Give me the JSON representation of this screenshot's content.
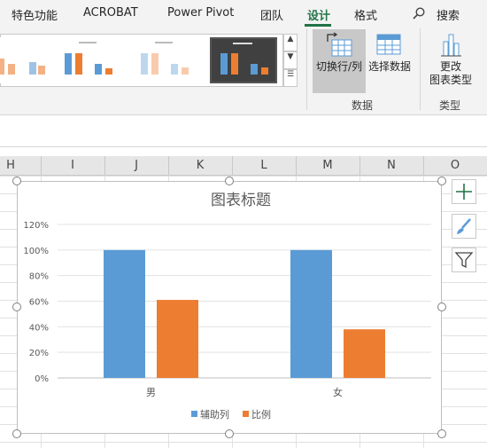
{
  "ribbon_tabs": [
    {
      "label": "特色功能",
      "active": false
    },
    {
      "label": "ACROBAT",
      "active": false
    },
    {
      "label": "Power Pivot",
      "active": false
    },
    {
      "label": "团队",
      "active": false
    },
    {
      "label": "设计",
      "active": true
    },
    {
      "label": "格式",
      "active": false
    }
  ],
  "search": {
    "label": "搜索",
    "icon": "search-icon"
  },
  "ribbon": {
    "data_group": {
      "label": "数据",
      "switch_row_col": {
        "label": "切换行/列",
        "icon": "switch-row-column-icon",
        "pressed": true
      },
      "select_data": {
        "label": "选择数据",
        "icon": "select-data-icon"
      }
    },
    "type_group": {
      "label": "类型",
      "change_type": {
        "label_line1": "更改",
        "label_line2": "图表类型",
        "icon": "change-chart-type-icon"
      }
    },
    "gallery": {
      "icons": [
        "scroll-up-icon",
        "scroll-down-icon",
        "more-styles-icon"
      ]
    }
  },
  "columns": [
    "H",
    "I",
    "J",
    "K",
    "L",
    "M",
    "N",
    "O"
  ],
  "side_buttons": [
    {
      "icon": "add-chart-element-icon"
    },
    {
      "icon": "chart-styles-brush-icon"
    },
    {
      "icon": "chart-filter-icon"
    }
  ],
  "colors": {
    "series1": "#5b9bd5",
    "series2": "#ed7d31",
    "accent": "#217346"
  },
  "chart_data": {
    "type": "bar",
    "title": "图表标题",
    "categories": [
      "男",
      "女"
    ],
    "series": [
      {
        "name": "辅助列",
        "values": [
          1.0,
          1.0
        ]
      },
      {
        "name": "比例",
        "values": [
          0.61,
          0.38
        ]
      }
    ],
    "ylim": [
      0,
      1.2
    ],
    "yticks": [
      "0%",
      "20%",
      "40%",
      "60%",
      "80%",
      "100%",
      "120%"
    ],
    "grid": true,
    "legend": "bottom"
  }
}
